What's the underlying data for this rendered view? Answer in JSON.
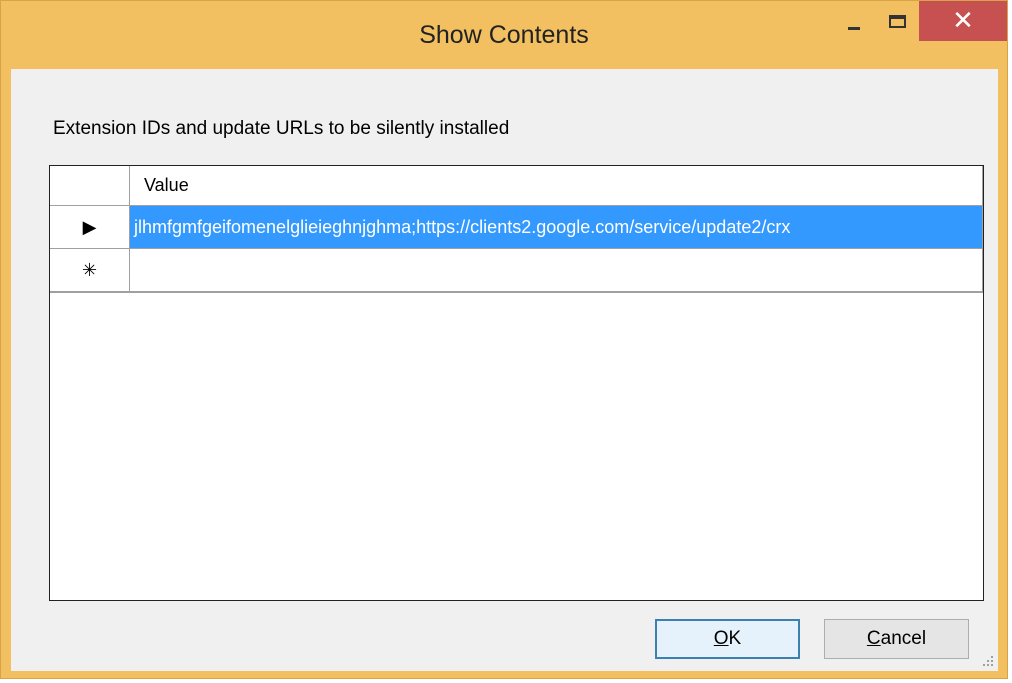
{
  "window": {
    "title": "Show Contents"
  },
  "dialog": {
    "description": "Extension IDs and update URLs to be silently installed",
    "grid": {
      "column_header": "Value",
      "rows": [
        {
          "marker": "▶",
          "value": "jlhmfgmfgeifomenelglieieghnjghma;https://clients2.google.com/service/update2/crx"
        }
      ],
      "new_row_marker": "✳"
    },
    "buttons": {
      "ok_mnemonic": "O",
      "ok_rest": "K",
      "cancel_mnemonic": "C",
      "cancel_rest": "ancel"
    }
  },
  "colors": {
    "title_bar": "#f2c061",
    "close_button": "#c75050",
    "selection": "#3399ff",
    "client_background": "#f0f0f0"
  },
  "icons": {
    "minimize": "minimize-icon",
    "maximize": "maximize-icon",
    "close": "close-icon",
    "current_row": "row-pointer-icon",
    "new_row": "new-row-icon",
    "size_grip": "size-grip-icon"
  }
}
